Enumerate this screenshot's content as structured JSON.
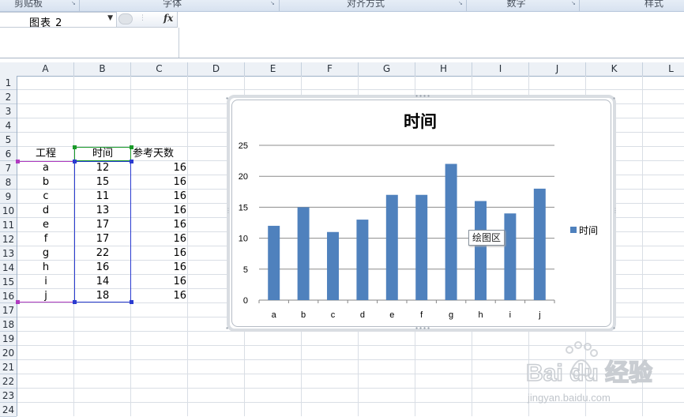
{
  "ribbon": {
    "groups": [
      "剪贴板",
      "字体",
      "对齐方式",
      "数字",
      "样式"
    ]
  },
  "formula_bar": {
    "name_box": "图表 2",
    "fx_label": "fx",
    "formula": ""
  },
  "columns": [
    "A",
    "B",
    "C",
    "D",
    "E",
    "F",
    "G",
    "H",
    "I",
    "J",
    "K",
    "L"
  ],
  "rows": [
    "1",
    "2",
    "3",
    "4",
    "5",
    "6",
    "7",
    "8",
    "9",
    "10",
    "11",
    "12",
    "13",
    "14",
    "15",
    "16",
    "17",
    "18",
    "19",
    "20",
    "21",
    "22",
    "23",
    "24"
  ],
  "table": {
    "headers": [
      "工程",
      "时间",
      "参考天数"
    ],
    "rows": [
      [
        "a",
        "12",
        "16"
      ],
      [
        "b",
        "15",
        "16"
      ],
      [
        "c",
        "11",
        "16"
      ],
      [
        "d",
        "13",
        "16"
      ],
      [
        "e",
        "17",
        "16"
      ],
      [
        "f",
        "17",
        "16"
      ],
      [
        "g",
        "22",
        "16"
      ],
      [
        "h",
        "16",
        "16"
      ],
      [
        "i",
        "14",
        "16"
      ],
      [
        "j",
        "18",
        "16"
      ]
    ]
  },
  "chart_tooltip": "绘图区",
  "watermark": {
    "brand": "Bai du 经验",
    "url": "jingyan.baidu.com"
  },
  "colors": {
    "bar": "#4f81bd",
    "selection_blue": "#2a3bd0",
    "selection_green": "#1a9a2a",
    "selection_purple": "#b03ac0"
  },
  "chart_data": {
    "type": "bar",
    "title": "时间",
    "categories": [
      "a",
      "b",
      "c",
      "d",
      "e",
      "f",
      "g",
      "h",
      "i",
      "j"
    ],
    "series": [
      {
        "name": "时间",
        "values": [
          12,
          15,
          11,
          13,
          17,
          17,
          22,
          16,
          14,
          18
        ]
      }
    ],
    "ylim": [
      0,
      25
    ],
    "yticks": [
      "0",
      "5",
      "10",
      "15",
      "20",
      "25"
    ],
    "grid": true,
    "legend": "right"
  }
}
